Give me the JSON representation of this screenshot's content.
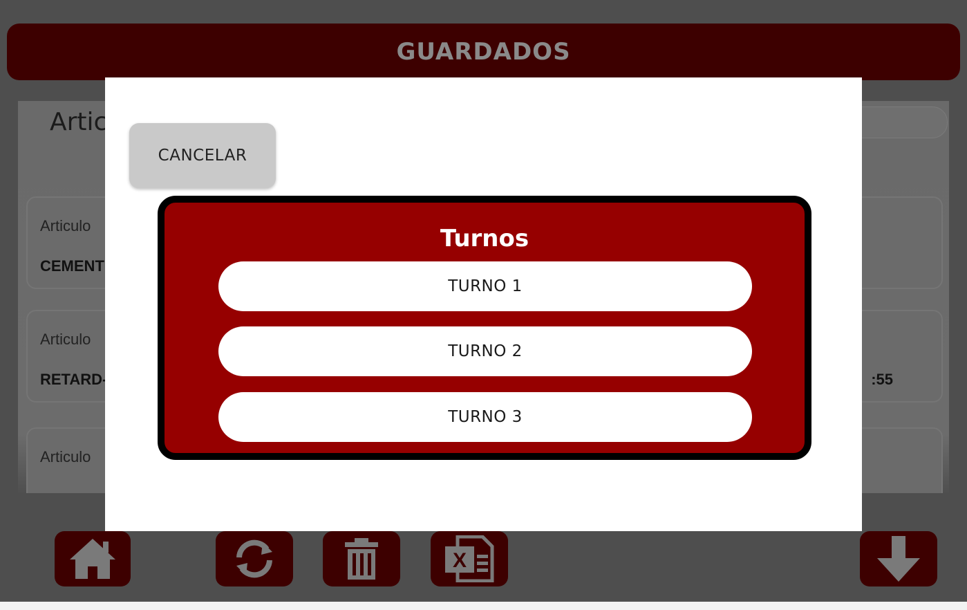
{
  "header": {
    "title": "GUARDADOS"
  },
  "main": {
    "section_title": "Artic",
    "cards": [
      {
        "label": "Articulo",
        "value": "CEMENT",
        "right_value": ""
      },
      {
        "label": "Articulo",
        "value": "RETARD-",
        "right_value": ":55"
      },
      {
        "label": "Articulo",
        "value": "",
        "right_value": ""
      }
    ]
  },
  "footer": {
    "buttons": [
      {
        "icon": "home-icon"
      },
      {
        "icon": "refresh-icon"
      },
      {
        "icon": "trash-icon"
      },
      {
        "icon": "excel-icon"
      },
      {
        "icon": "download-arrow-icon"
      }
    ]
  },
  "modal": {
    "cancel_label": "CANCELAR",
    "panel_title": "Turnos",
    "shifts": [
      "TURNO 1",
      "TURNO 2",
      "TURNO 3"
    ]
  },
  "colors": {
    "brand_red": "#960000",
    "dim_red": "#3d0000",
    "overlay_gray": "#4e4e4e"
  }
}
